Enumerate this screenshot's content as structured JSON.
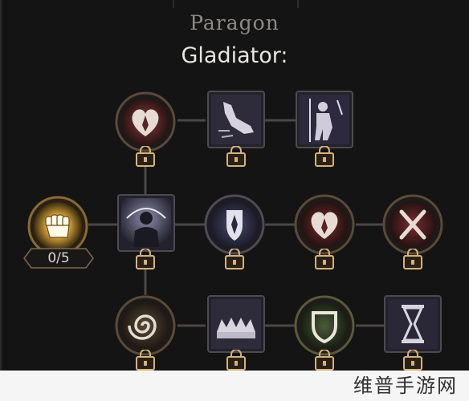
{
  "header": {
    "category": "Paragon",
    "title": "Gladiator:"
  },
  "start_node": {
    "progress": "0/5",
    "icon": "fist-icon"
  },
  "nodes": [
    {
      "id": "r1c1",
      "icon": "heart-shield-icon",
      "shape": "circle",
      "locked": true
    },
    {
      "id": "r1c2",
      "icon": "kicking-leg-icon",
      "shape": "square",
      "locked": true
    },
    {
      "id": "r1c3",
      "icon": "warrior-spear-icon",
      "shape": "square",
      "locked": true
    },
    {
      "id": "r2c1",
      "icon": "silhouette-aura-icon",
      "shape": "square",
      "locked": true
    },
    {
      "id": "r2c2",
      "icon": "shield-crest-icon",
      "shape": "circle",
      "locked": true
    },
    {
      "id": "r2c3",
      "icon": "heart-shield-icon",
      "shape": "circle",
      "locked": true
    },
    {
      "id": "r2c4",
      "icon": "crossed-swords-icon",
      "shape": "circle",
      "locked": true
    },
    {
      "id": "r3c1",
      "icon": "spiral-icon",
      "shape": "circle",
      "locked": true
    },
    {
      "id": "r3c2",
      "icon": "bear-trap-icon",
      "shape": "square",
      "locked": true
    },
    {
      "id": "r3c3",
      "icon": "shield-icon",
      "shape": "circle",
      "locked": true
    },
    {
      "id": "r3c4",
      "icon": "hourglass-icon",
      "shape": "square",
      "locked": true
    }
  ],
  "watermark": {
    "text": "维普手游网"
  },
  "colors": {
    "background": "#141414",
    "connector": "#4a4744",
    "gold": "#c9a45a",
    "lock": "#d4b37a"
  }
}
